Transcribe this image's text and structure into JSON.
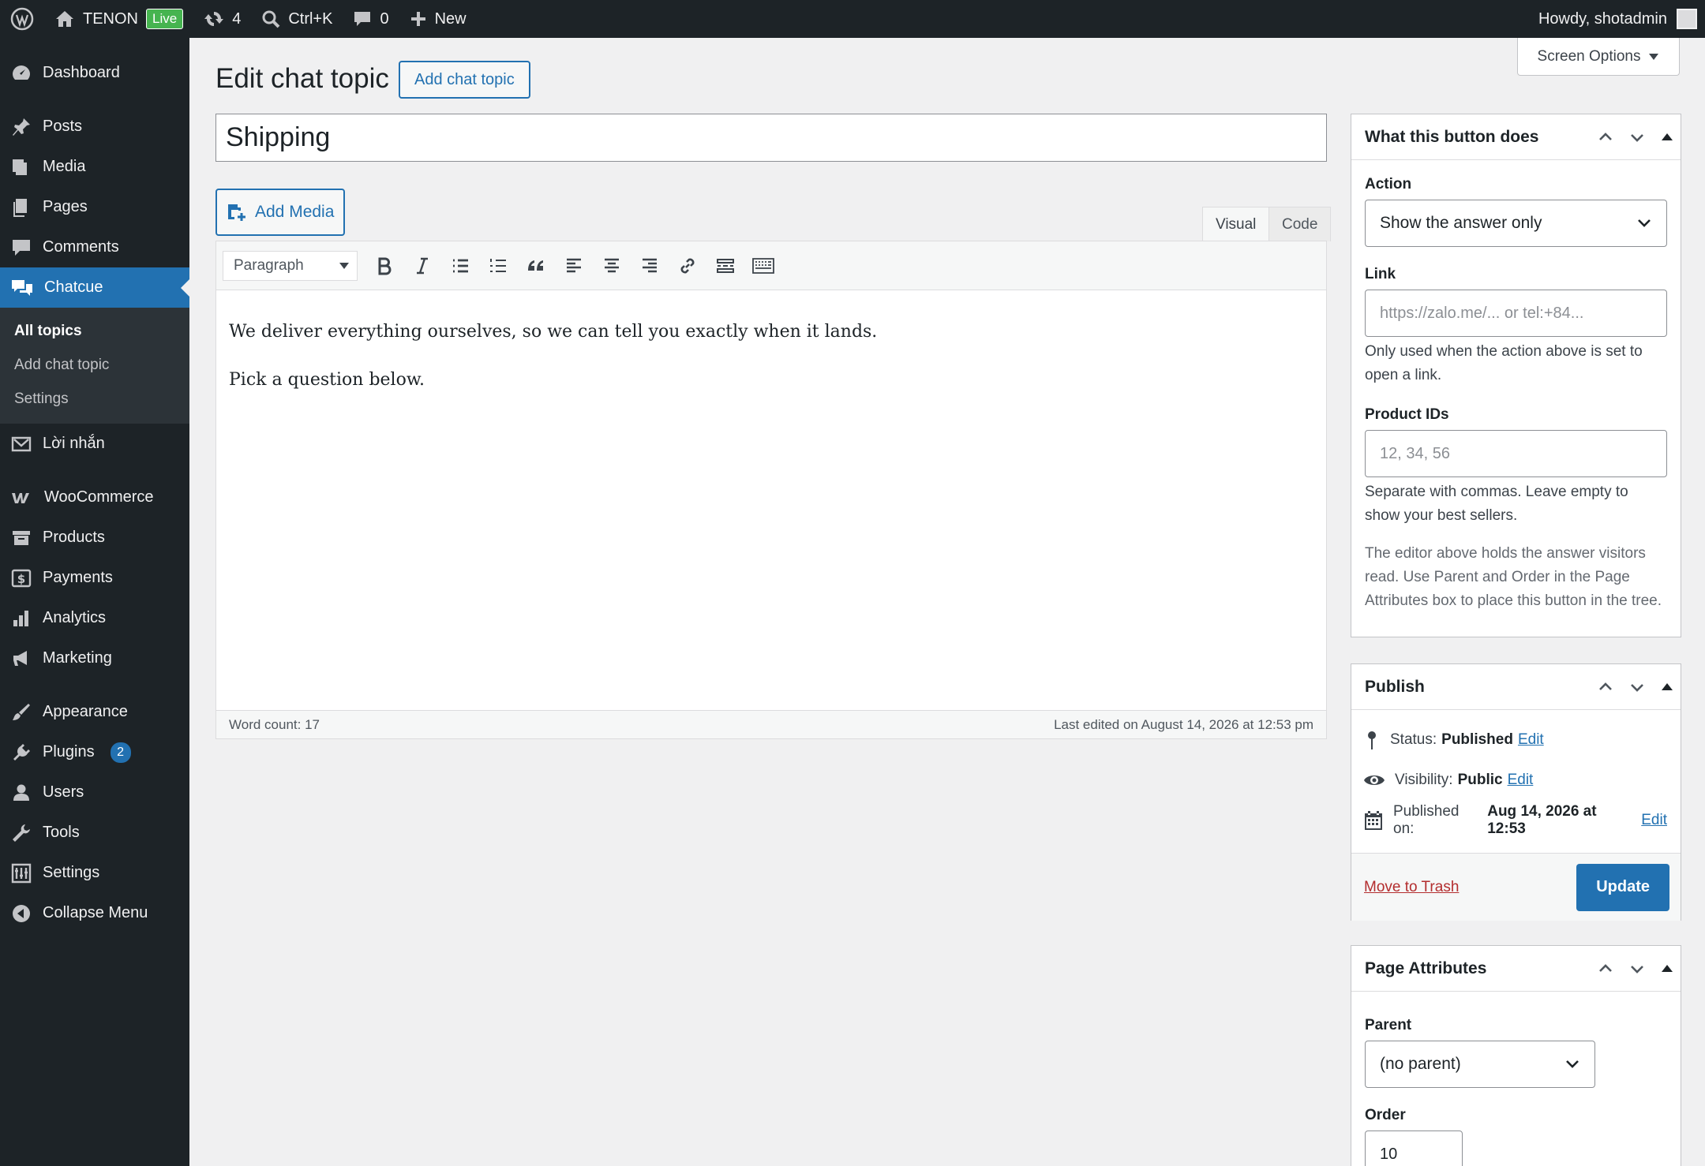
{
  "adminbar": {
    "site_name": "TENON",
    "live_badge": "Live",
    "updates_count": "4",
    "search_shortcut": "Ctrl+K",
    "comments_count": "0",
    "new_label": "New",
    "howdy": "Howdy, shotadmin"
  },
  "sidebar": {
    "dashboard": "Dashboard",
    "posts": "Posts",
    "media": "Media",
    "pages": "Pages",
    "comments": "Comments",
    "chatcue": "Chatcue",
    "sub_all_topics": "All topics",
    "sub_add_topic": "Add chat topic",
    "sub_settings": "Settings",
    "loi_nhan": "Lời nhắn",
    "woocommerce": "WooCommerce",
    "products": "Products",
    "payments": "Payments",
    "analytics": "Analytics",
    "marketing": "Marketing",
    "appearance": "Appearance",
    "plugins": "Plugins",
    "plugins_badge": "2",
    "users": "Users",
    "tools": "Tools",
    "settings": "Settings",
    "collapse": "Collapse Menu"
  },
  "header": {
    "screen_options": "Screen Options",
    "page_title": "Edit chat topic",
    "add_new": "Add chat topic"
  },
  "editor": {
    "title_value": "Shipping",
    "add_media": "Add Media",
    "tab_visual": "Visual",
    "tab_code": "Code",
    "format_value": "Paragraph",
    "paragraphs": [
      "We deliver everything ourselves, so we can tell you exactly when it lands.",
      "Pick a question below."
    ],
    "word_count": "Word count: 17",
    "last_edited": "Last edited on August 14, 2026 at 12:53 pm"
  },
  "button_box": {
    "title": "What this button does",
    "action_label": "Action",
    "action_value": "Show the answer only",
    "link_label": "Link",
    "link_placeholder": "https://zalo.me/... or tel:+84...",
    "link_help": "Only used when the action above is set to open a link.",
    "product_label": "Product IDs",
    "product_placeholder": "12, 34, 56",
    "product_help": "Separate with commas. Leave empty to show your best sellers.",
    "note": "The editor above holds the answer visitors read. Use Parent and Order in the Page Attributes box to place this button in the tree."
  },
  "publish_box": {
    "title": "Publish",
    "status_label": "Status:",
    "status_value": "Published",
    "visibility_label": "Visibility:",
    "visibility_value": "Public",
    "published_label": "Published on:",
    "published_value": "Aug 14, 2026 at 12:53",
    "edit": "Edit",
    "trash": "Move to Trash",
    "update": "Update"
  },
  "attributes_box": {
    "title": "Page Attributes",
    "parent_label": "Parent",
    "parent_value": "(no parent)",
    "order_label": "Order",
    "order_value": "10"
  },
  "colors": {
    "accent": "#2271b1",
    "sidebar_bg": "#1d2327",
    "live_green": "#46b450",
    "trash_red": "#b32d2e"
  }
}
